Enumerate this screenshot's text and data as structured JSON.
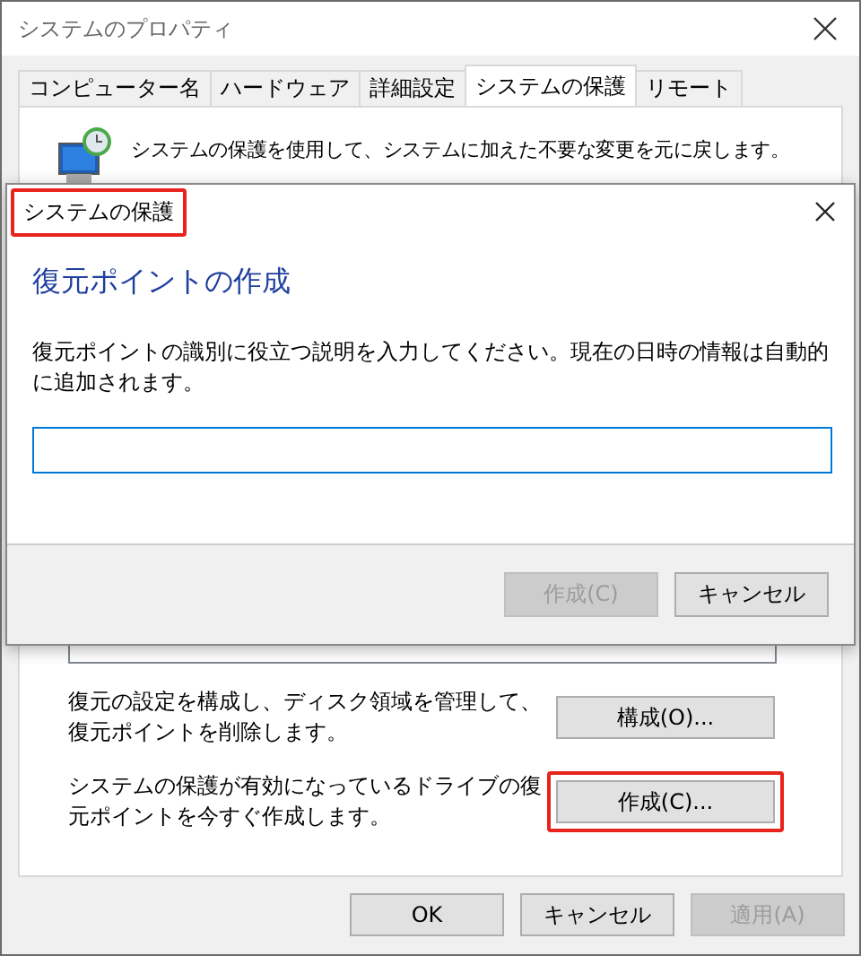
{
  "window": {
    "title": "システムのプロパティ"
  },
  "tabs": [
    {
      "label": "コンピューター名",
      "selected": false
    },
    {
      "label": "ハードウェア",
      "selected": false
    },
    {
      "label": "詳細設定",
      "selected": false
    },
    {
      "label": "システムの保護",
      "selected": true
    },
    {
      "label": "リモート",
      "selected": false
    }
  ],
  "panel": {
    "intro": "システムの保護を使用して、システムに加えた不要な変更を元に戻します。",
    "rows": [
      {
        "text": "復元の設定を構成し、ディスク領域を管理して、復元ポイントを削除します。",
        "button": "構成(O)...",
        "highlighted": false
      },
      {
        "text": "システムの保護が有効になっているドライブの復元ポイントを今すぐ作成します。",
        "button": "作成(C)...",
        "highlighted": true
      }
    ]
  },
  "buttons": [
    {
      "label": "OK",
      "disabled": false
    },
    {
      "label": "キャンセル",
      "disabled": false
    },
    {
      "label": "適用(A)",
      "disabled": true
    }
  ],
  "dialog": {
    "title": "システムの保護",
    "title_highlighted": true,
    "heading": "復元ポイントの作成",
    "description": "復元ポイントの識別に役立つ説明を入力してください。現在の日時の情報は自動的に追加されます。",
    "buttons": [
      {
        "label": "作成(C)",
        "disabled": true
      },
      {
        "label": "キャンセル",
        "disabled": false
      }
    ]
  }
}
